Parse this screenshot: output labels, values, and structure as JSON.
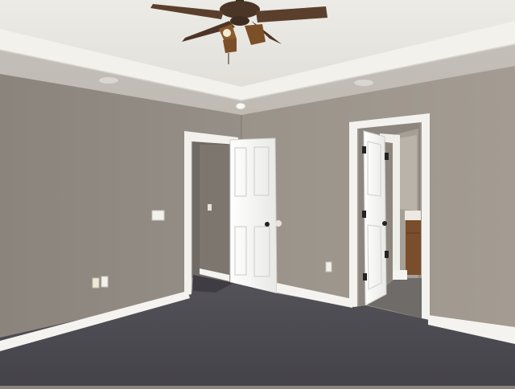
{
  "scene": {
    "description_label": "",
    "palette": {
      "ceiling": "#e9e6e0",
      "tray_band": "#f1efe9",
      "wall_left": "#8f8981",
      "wall_right": "#9b948b",
      "trim": "#f4f3ef",
      "carpet": "#4e4c50",
      "door_white": "#f5f5f2",
      "fan_bronze": "#4a3526",
      "vanity_wood": "#7a4e2c"
    },
    "icons": {
      "fan": "ceiling-fan-icon",
      "switch": "light-switch-icon",
      "outlet": "electrical-outlet-icon"
    }
  }
}
